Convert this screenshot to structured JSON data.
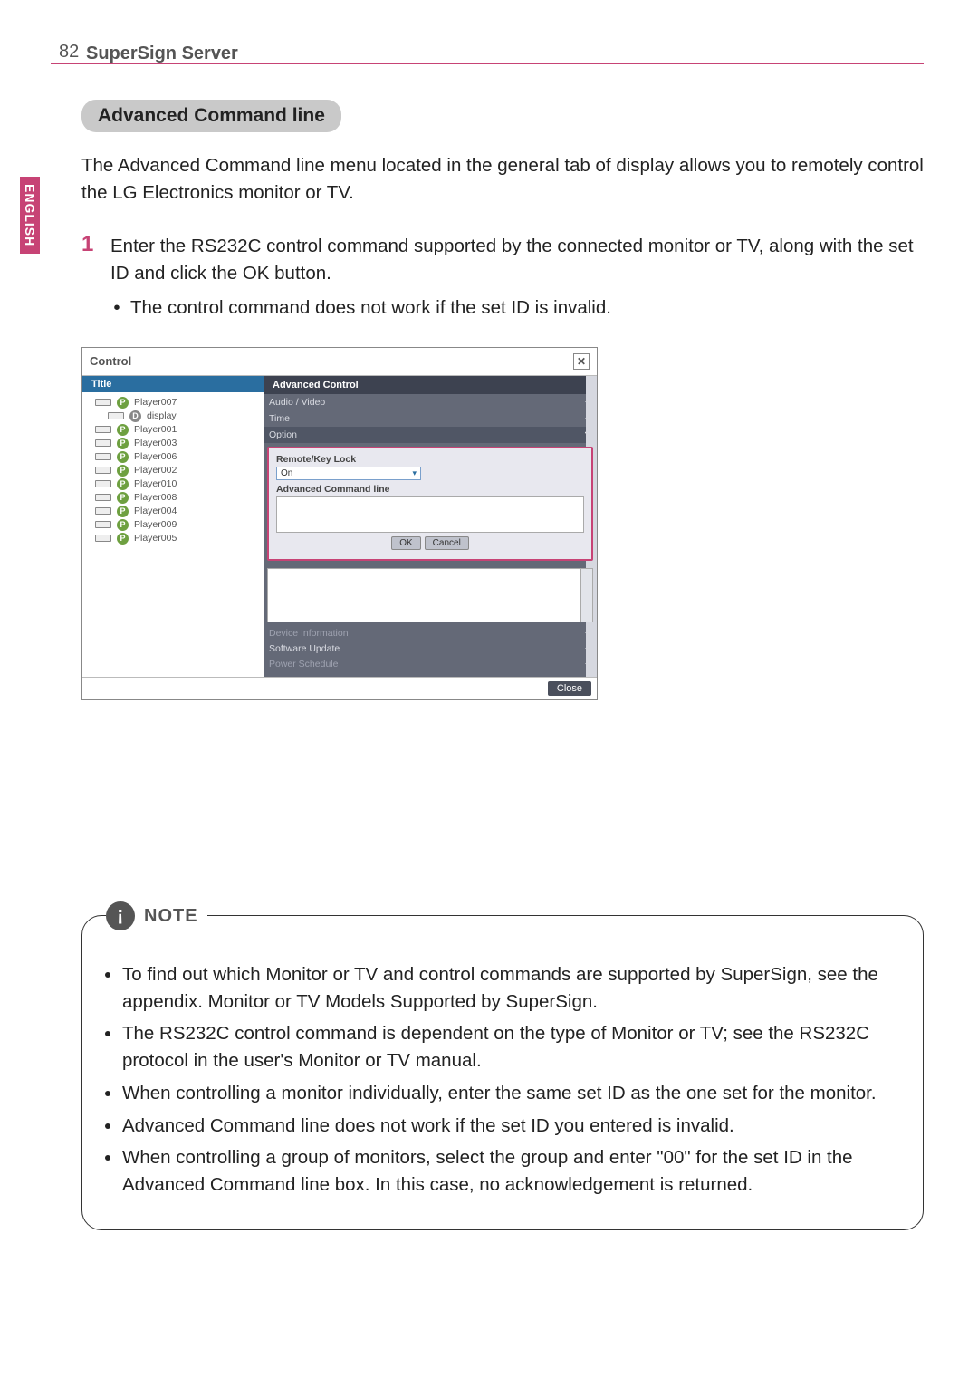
{
  "page": {
    "number": "82",
    "title": "SuperSign Server",
    "lang": "ENGLISH"
  },
  "section": {
    "pill": "Advanced Command line"
  },
  "intro": "The Advanced Command line menu located in the general tab of display allows you to remotely control the LG Electronics monitor or TV.",
  "step": {
    "num": "1",
    "text": "Enter the RS232C control command supported by the connected monitor or TV, along with the set ID and click the OK button.",
    "bullet": "The control command does not work if the set ID is invalid."
  },
  "shot": {
    "header": "Control",
    "close_x": "✕",
    "title_head": "Title",
    "players": [
      {
        "label": "Player007",
        "type": "p"
      },
      {
        "label": "display",
        "type": "d"
      },
      {
        "label": "Player001",
        "type": "p"
      },
      {
        "label": "Player003",
        "type": "p"
      },
      {
        "label": "Player006",
        "type": "p"
      },
      {
        "label": "Player002",
        "type": "p"
      },
      {
        "label": "Player010",
        "type": "p"
      },
      {
        "label": "Player008",
        "type": "p"
      },
      {
        "label": "Player004",
        "type": "p"
      },
      {
        "label": "Player009",
        "type": "p"
      },
      {
        "label": "Player005",
        "type": "p"
      }
    ],
    "adv_head": "Advanced Control",
    "subrows": {
      "audio": "Audio / Video",
      "time": "Time",
      "option": "Option"
    },
    "remote_lbl": "Remote/Key Lock",
    "remote_val": "On",
    "acmd_lbl": "Advanced Command line",
    "ok": "OK",
    "cancel": "Cancel",
    "devinfo": "Device Information",
    "softup": "Software Update",
    "psched": "Power Schedule",
    "close": "Close"
  },
  "note": {
    "label": "NOTE",
    "items": [
      "To find out which Monitor or TV and control commands are supported by SuperSign, see the appendix. Monitor or TV Models Supported by SuperSign.",
      "The RS232C control command is dependent on the type of Monitor or TV; see the RS232C protocol in the user's Monitor or TV manual.",
      "When controlling a monitor individually, enter the same set ID as the one set for the monitor.",
      "Advanced Command line does not work if the set ID you entered is invalid.",
      "When controlling a group of monitors, select the group and enter \"00\" for the set ID in the Advanced Command line box. In this case, no acknowledgement is returned."
    ]
  }
}
